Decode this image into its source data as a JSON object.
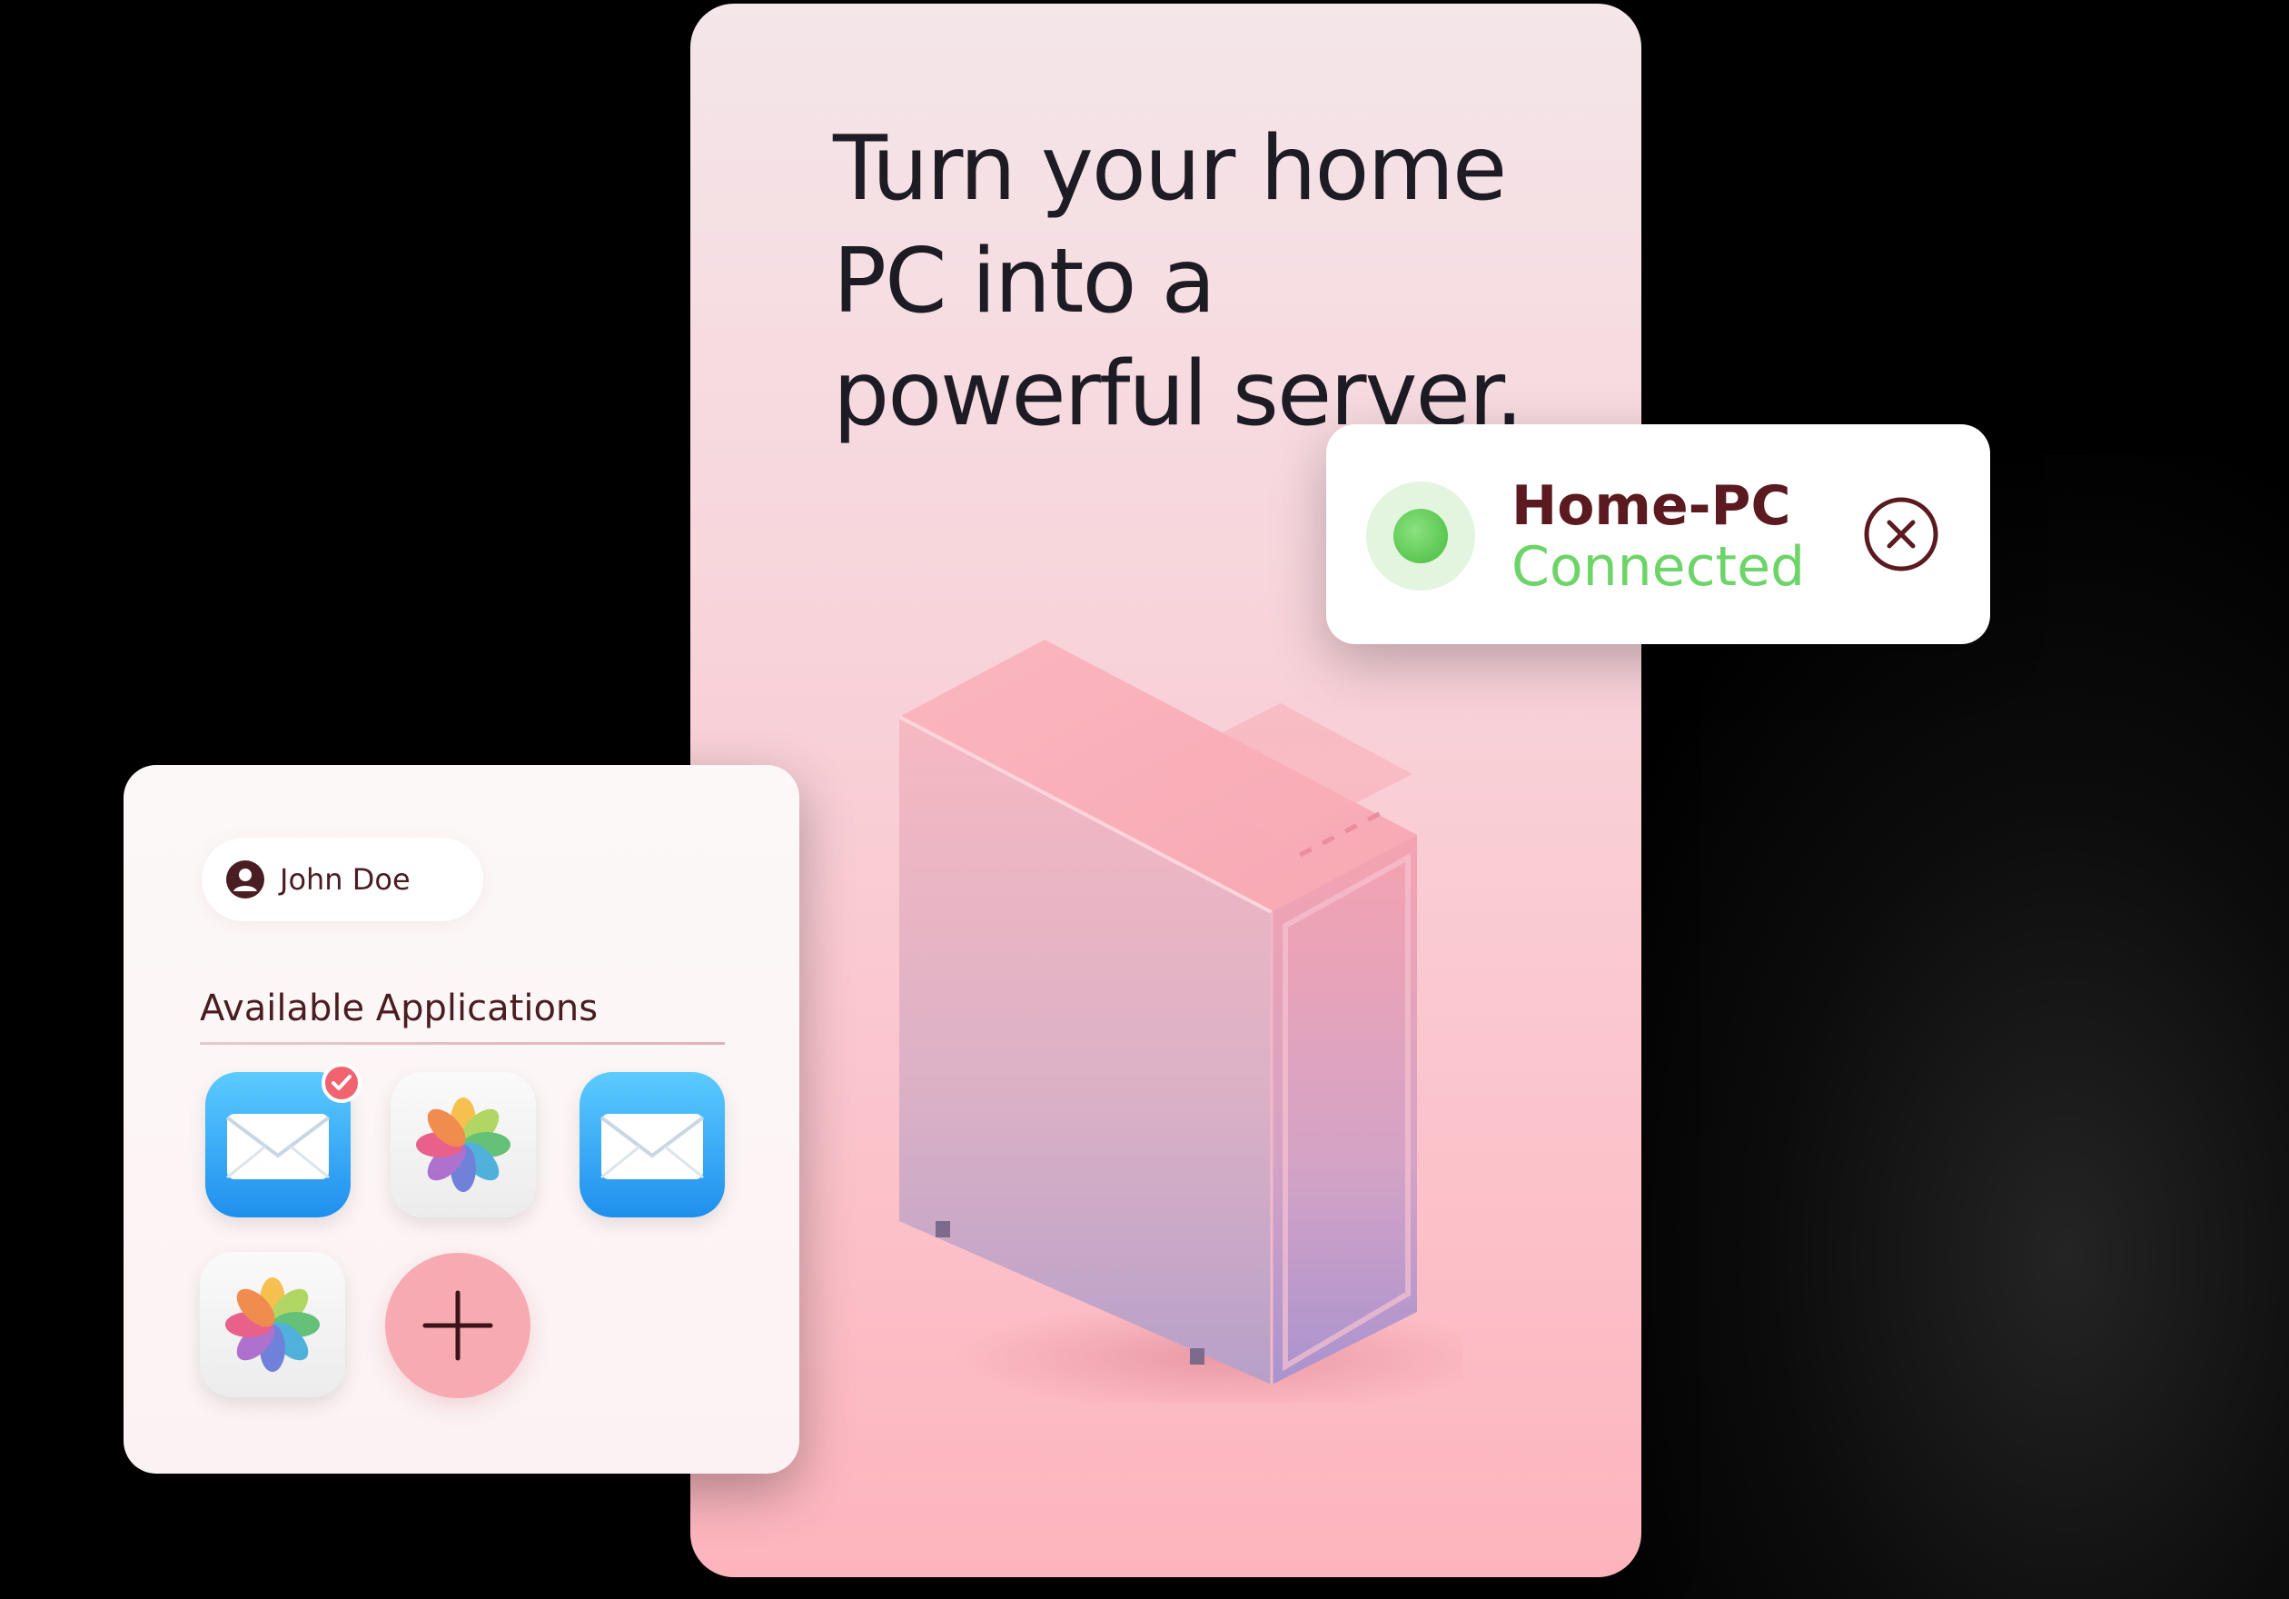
{
  "hero": {
    "headline": "Turn your home PC into a powerful server."
  },
  "connection": {
    "device_name": "Home-PC",
    "status": "Connected",
    "status_color": "#6dd468",
    "name_color": "#5a1a1f"
  },
  "apps_panel": {
    "user_name": "John Doe",
    "section_title": "Available Applications",
    "apps": [
      {
        "icon": "mail-icon",
        "selected": true
      },
      {
        "icon": "photos-icon",
        "selected": false
      },
      {
        "icon": "mail-icon",
        "selected": false
      },
      {
        "icon": "photos-icon",
        "selected": false
      }
    ],
    "add_icon": "plus-icon"
  },
  "colors": {
    "accent_pink": "#f7aab1",
    "badge_red": "#f0636f",
    "text_dark": "#1d1b24"
  }
}
